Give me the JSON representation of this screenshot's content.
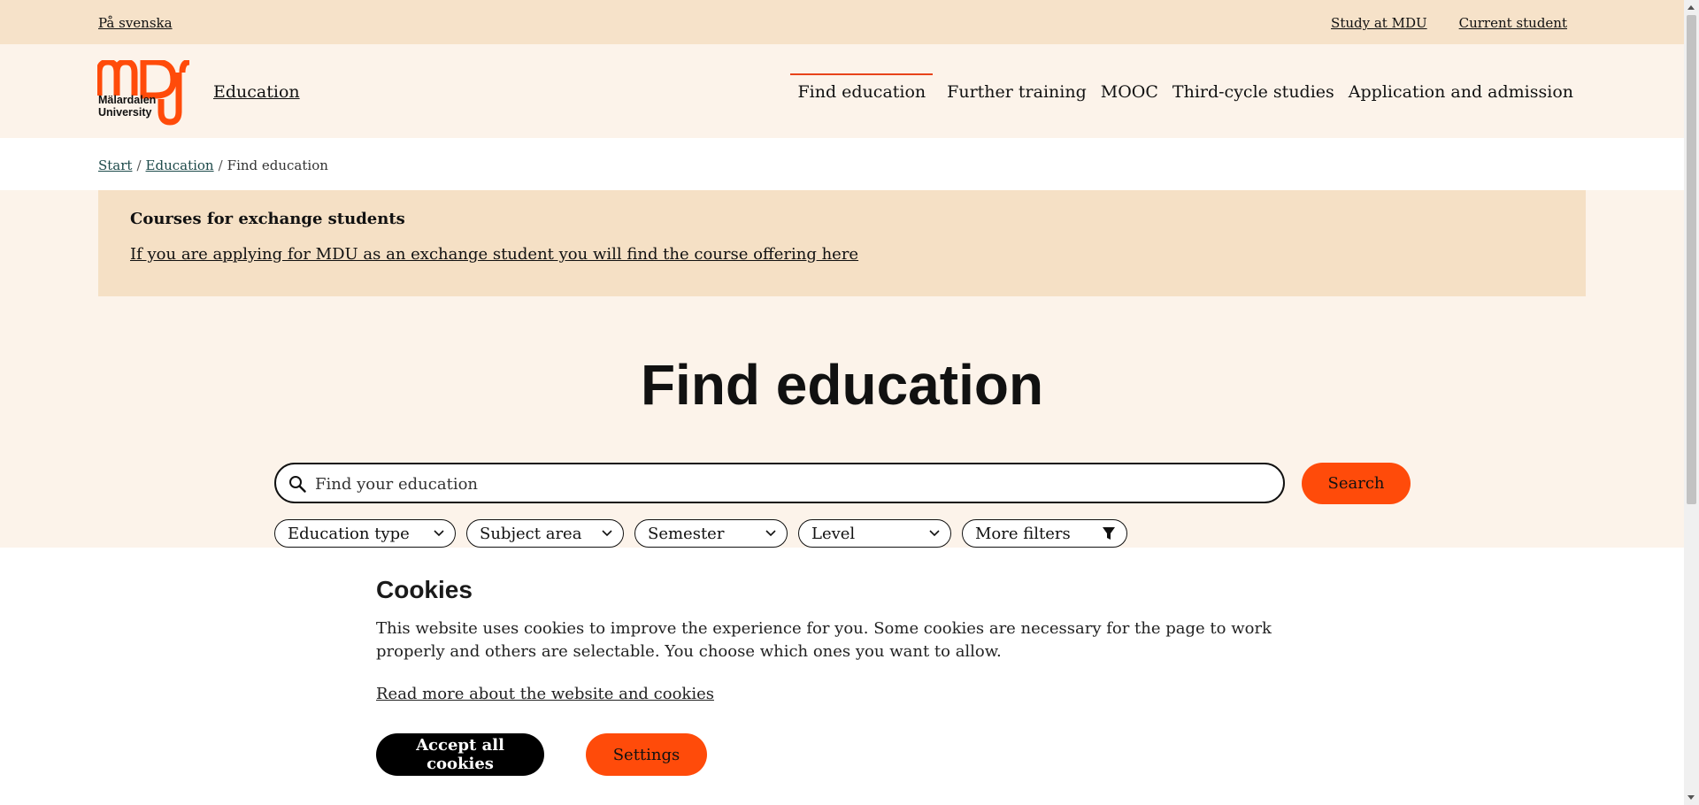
{
  "topbar": {
    "language_link": "På svenska",
    "links": [
      "Study at MDU",
      "Current student"
    ]
  },
  "header": {
    "logo_name_line1": "Mälardalen",
    "logo_name_line2": "University",
    "site_label": "Education",
    "nav": [
      "Find education",
      "Further training",
      "MOOC",
      "Third-cycle studies",
      "Application and admission"
    ],
    "active_nav": "Find education"
  },
  "breadcrumb": {
    "items": [
      "Start",
      "Education"
    ],
    "separator": "/",
    "current": "Find education"
  },
  "notice": {
    "title": "Courses for exchange students",
    "link": "If you are applying for MDU as an exchange student you will find the course offering here"
  },
  "main": {
    "title": "Find education",
    "search_placeholder": "Find your education",
    "search_button": "Search",
    "filters": [
      "Education type",
      "Subject area",
      "Semester",
      "Level"
    ],
    "more_filters": "More filters"
  },
  "cookie_banner": {
    "title": "Cookies",
    "text": "This website uses cookies to improve the experience for you. Some cookies are necessary for the page to work properly and others are selectable. You choose which ones you want to allow.",
    "read_more": "Read more about the website and cookies",
    "accept_button": "Accept all cookies",
    "settings_button": "Settings"
  },
  "colors": {
    "brand_orange": "#ff4b0a",
    "topbar_bg": "#f6e2c9",
    "page_bg": "#fcf3ea"
  }
}
